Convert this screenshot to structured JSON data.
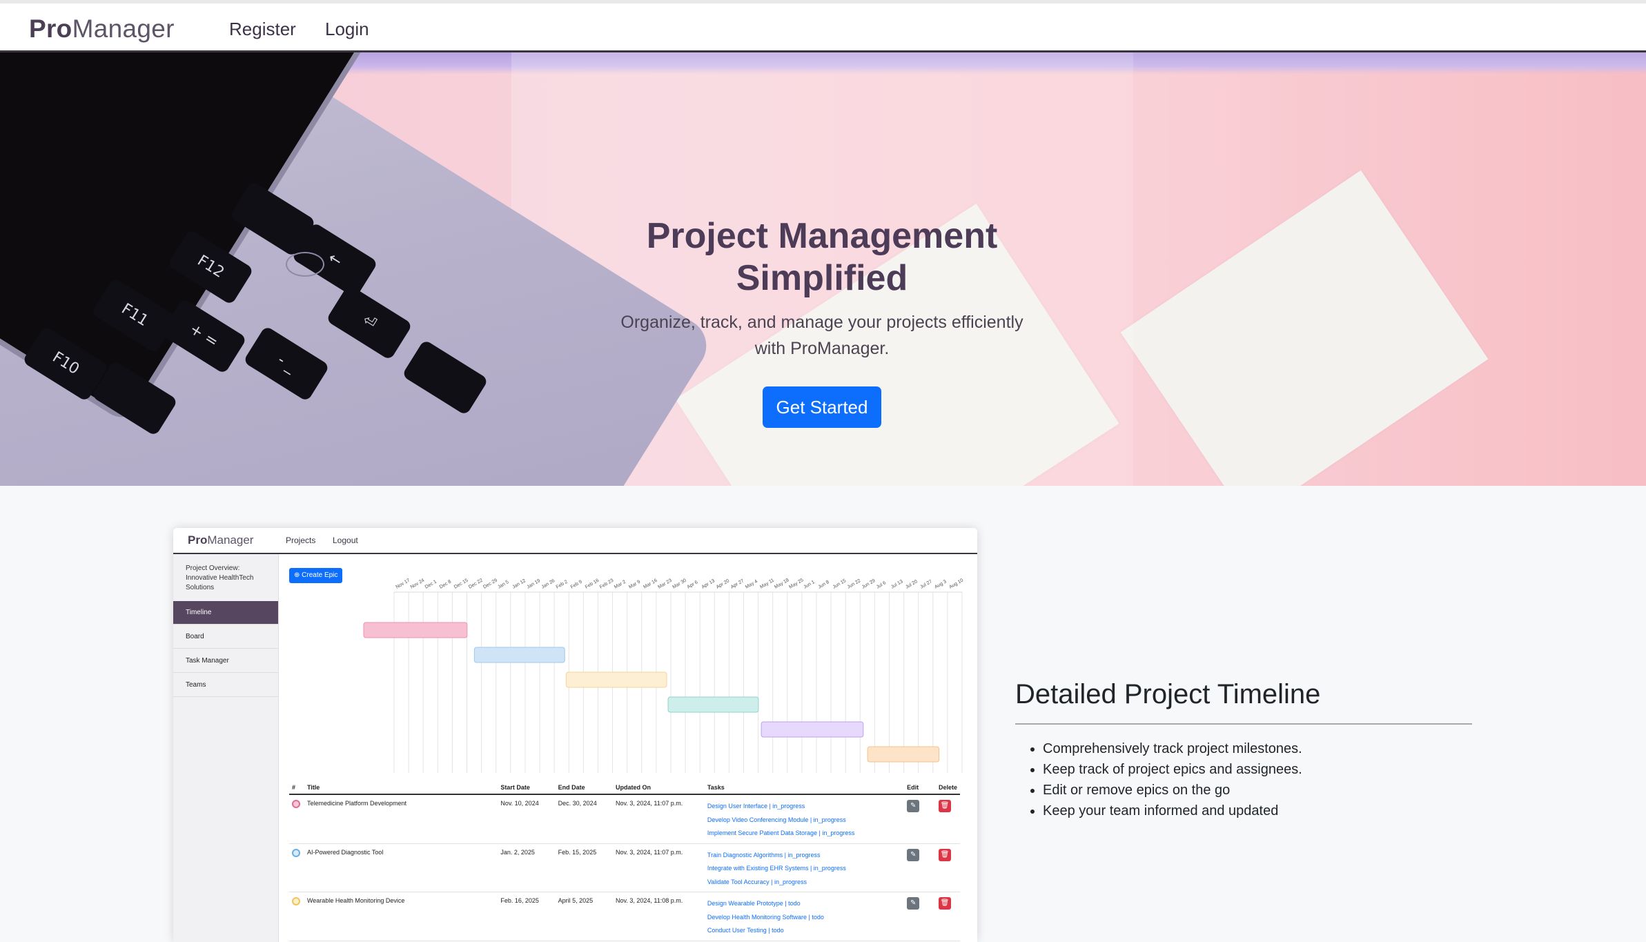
{
  "nav": {
    "brand_bold": "Pro",
    "brand_rest": "Manager",
    "register": "Register",
    "login": "Login"
  },
  "hero": {
    "title_line1": "Project Management",
    "title_line2": "Simplified",
    "subtitle_line1": "Organize, track, and manage your projects efficiently",
    "subtitle_line2": "with ProManager.",
    "cta": "Get Started",
    "keys": [
      "F10",
      "F11",
      "F12",
      "+ =",
      "- _",
      "←",
      "⏎"
    ]
  },
  "preview": {
    "brand_bold": "Pro",
    "brand_rest": "Manager",
    "nav_projects": "Projects",
    "nav_logout": "Logout",
    "project_overview": "Project Overview: Innovative HealthTech Solutions",
    "sidebar": [
      "Timeline",
      "Board",
      "Task Manager",
      "Teams"
    ],
    "create_epic": "⊕ Create Epic",
    "timeline_dates": [
      "Nov 17",
      "Nov 24",
      "Dec 1",
      "Dec 8",
      "Dec 15",
      "Dec 22",
      "Dec 29",
      "Jan 5",
      "Jan 12",
      "Jan 19",
      "Jan 26",
      "Feb 2",
      "Feb 9",
      "Feb 16",
      "Feb 23",
      "Mar 2",
      "Mar 9",
      "Mar 16",
      "Mar 23",
      "Mar 30",
      "Apr 6",
      "Apr 13",
      "Apr 20",
      "Apr 27",
      "May 4",
      "May 11",
      "May 18",
      "May 25",
      "Jun 1",
      "Jun 8",
      "Jun 15",
      "Jun 22",
      "Jun 29",
      "Jul 6",
      "Jul 13",
      "Jul 20",
      "Jul 27",
      "Aug 3",
      "Aug 10"
    ],
    "gantt_bars": [
      {
        "start": 0,
        "end": 7.1,
        "color": "#f7c0d2",
        "stroke": "#ef8fae"
      },
      {
        "start": 7.6,
        "end": 13.8,
        "color": "#cfe5f7",
        "stroke": "#9ec9ea"
      },
      {
        "start": 13.9,
        "end": 20.8,
        "color": "#fcefd3",
        "stroke": "#f3d59a"
      },
      {
        "start": 20.9,
        "end": 27.1,
        "color": "#cdeeea",
        "stroke": "#93d2cb"
      },
      {
        "start": 27.3,
        "end": 34.3,
        "color": "#e6d9fb",
        "stroke": "#bba1ef"
      },
      {
        "start": 34.6,
        "end": 39.5,
        "color": "#fde3c8",
        "stroke": "#f5c089"
      }
    ],
    "table": {
      "headers": [
        "#",
        "Title",
        "Start Date",
        "End Date",
        "Updated On",
        "Tasks",
        "Edit",
        "Delete"
      ],
      "rows": [
        {
          "dot_color": "#e56a93",
          "dot_fill": "#f9c7d6",
          "title": "Telemedicine Platform Development",
          "start": "Nov. 10, 2024",
          "end": "Dec. 30, 2024",
          "updated": "Nov. 3, 2024, 11:07 p.m.",
          "tasks": [
            "Design User Interface | in_progress",
            "Develop Video Conferencing Module | in_progress",
            "Implement Secure Patient Data Storage | in_progress"
          ]
        },
        {
          "dot_color": "#6aaee3",
          "dot_fill": "#d6eaf9",
          "title": "AI-Powered Diagnostic Tool",
          "start": "Jan. 2, 2025",
          "end": "Feb. 15, 2025",
          "updated": "Nov. 3, 2024, 11:07 p.m.",
          "tasks": [
            "Train Diagnostic Algorithms | in_progress",
            "Integrate with Existing EHR Systems | in_progress",
            "Validate Tool Accuracy | in_progress"
          ]
        },
        {
          "dot_color": "#efc55b",
          "dot_fill": "#fcefc8",
          "title": "Wearable Health Monitoring Device",
          "start": "Feb. 16, 2025",
          "end": "April 5, 2025",
          "updated": "Nov. 3, 2024, 11:08 p.m.",
          "tasks": [
            "Design Wearable Prototype | todo",
            "Develop Health Monitoring Software | todo",
            "Conduct User Testing | todo"
          ]
        }
      ]
    }
  },
  "feature": {
    "heading": "Detailed Project Timeline",
    "bullets": [
      "Comprehensively track project milestones.",
      "Keep track of project epics and assignees.",
      "Edit or remove epics on the go",
      "Keep your team informed and updated"
    ]
  }
}
